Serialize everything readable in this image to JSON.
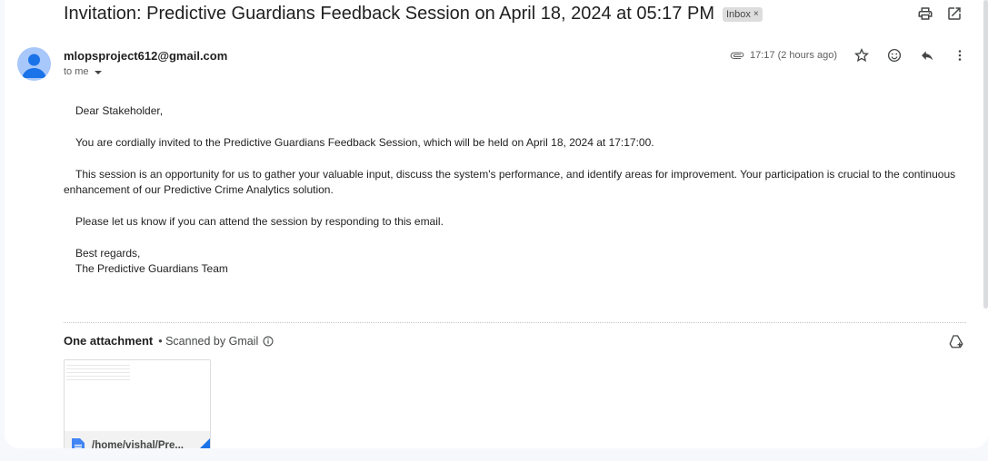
{
  "email": {
    "subject": "Invitation: Predictive Guardians Feedback Session on April 18, 2024 at 05:17 PM",
    "label": "Inbox",
    "label_close": "×",
    "sender": "mlopsproject612@gmail.com",
    "recipient": "to me",
    "time": "17:17 (2 hours ago)",
    "body": {
      "greeting": "Dear Stakeholder,",
      "p1": "You are cordially invited to the Predictive Guardians Feedback Session, which will be held on April 18, 2024 at 17:17:00.",
      "p2": "This session is an opportunity for us to gather your valuable input, discuss the system's performance, and identify areas for improvement. Your participation is crucial to the continuous enhancement of our Predictive Crime Analytics solution.",
      "p3": "Please let us know if you can attend the session by responding to this email.",
      "closing": "Best regards,",
      "signature": "The Predictive Guardians Team"
    },
    "attachments": {
      "count_label": "One attachment",
      "scanned_label": "• Scanned by Gmail",
      "file_name": "/home/vishal/Pre..."
    }
  },
  "icons": {
    "print": "print-icon",
    "open_new_window": "open-in-new-window-icon",
    "attachment": "paperclip-icon",
    "star": "star-icon",
    "emoji": "emoji-reaction-icon",
    "reply": "reply-icon",
    "more": "more-vert-icon",
    "info": "info-icon",
    "add_to_drive": "add-to-drive-icon",
    "doc": "google-doc-icon"
  },
  "colors": {
    "avatar_bg": "#a8c7fa",
    "avatar_fg": "#1a73e8",
    "doc_blue": "#4285f4"
  }
}
